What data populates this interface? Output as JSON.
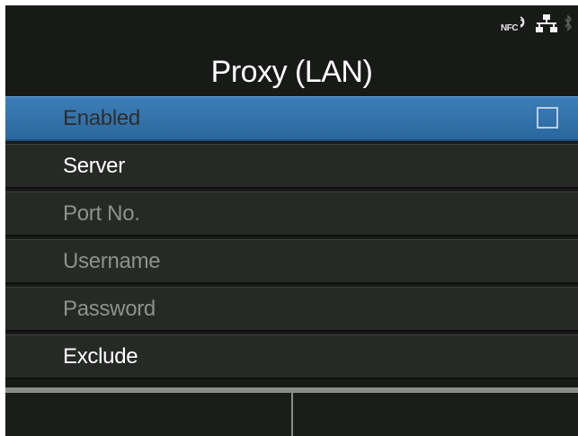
{
  "status_bar": {
    "nfc_label": "NFC",
    "icons": [
      "nfc-icon",
      "lan-network-icon",
      "bluetooth-icon"
    ]
  },
  "screen": {
    "title": "Proxy (LAN)"
  },
  "menu": {
    "items": [
      {
        "label": "Enabled",
        "state": "selected",
        "checked": false
      },
      {
        "label": "Server",
        "state": "active"
      },
      {
        "label": "Port No.",
        "state": "disabled"
      },
      {
        "label": "Username",
        "state": "disabled"
      },
      {
        "label": "Password",
        "state": "disabled"
      },
      {
        "label": "Exclude",
        "state": "active"
      }
    ]
  },
  "softkeys": {
    "left_label": "",
    "right_label": ""
  },
  "colors": {
    "background": "#181a18",
    "selection": "#3d7eb8",
    "active_text": "#ffffff",
    "disabled_text": "#8e918e"
  }
}
